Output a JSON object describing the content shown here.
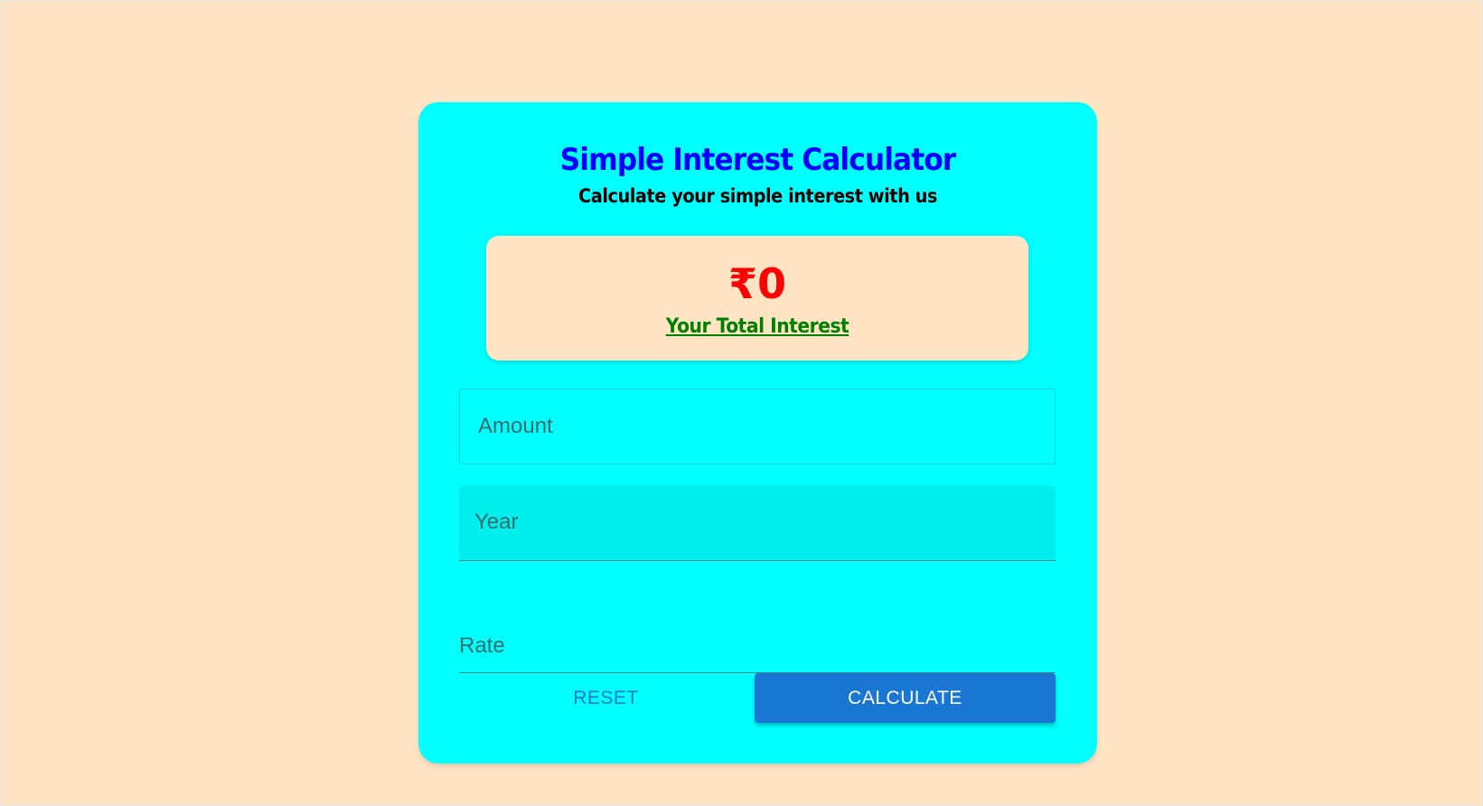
{
  "colors": {
    "page_background": "#ffe4c4",
    "card_background": "#00ffff",
    "title": "#0000ff",
    "result_value": "#ff0000",
    "result_label": "#008000",
    "primary_button": "#1976d2"
  },
  "header": {
    "title": "Simple Interest Calculator",
    "subtitle": "Calculate your simple interest with us"
  },
  "result": {
    "value": "₹0",
    "label": "Your Total Interest"
  },
  "form": {
    "amount_placeholder": "Amount",
    "year_placeholder": "Year",
    "rate_placeholder": "Rate"
  },
  "actions": {
    "reset_label": "RESET",
    "calculate_label": "CALCULATE"
  }
}
